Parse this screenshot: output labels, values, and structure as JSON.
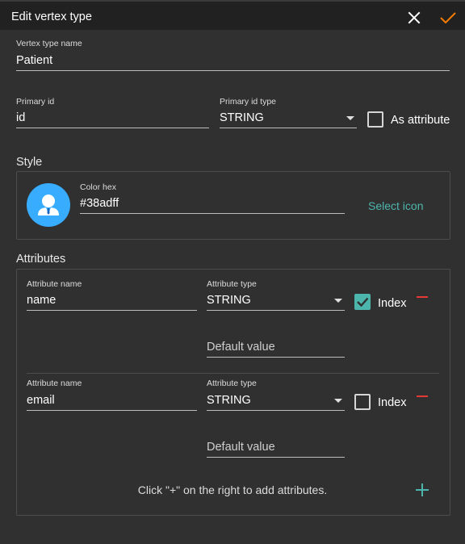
{
  "dialog": {
    "title": "Edit vertex type",
    "close_icon": "close-icon",
    "confirm_icon": "check-icon",
    "confirm_color": "#f57c00"
  },
  "vertex": {
    "name_label": "Vertex type name",
    "name_value": "Patient",
    "primary_id_label": "Primary id",
    "primary_id_value": "id",
    "primary_id_type_label": "Primary id type",
    "primary_id_type_value": "STRING",
    "as_attribute_label": "As attribute",
    "as_attribute_checked": false
  },
  "style": {
    "section_label": "Style",
    "color_hex_label": "Color hex",
    "color_hex_value": "#38adff",
    "avatar_color": "#38adff",
    "avatar_icon": "person-icon",
    "select_icon_label": "Select icon"
  },
  "attributes": {
    "section_label": "Attributes",
    "items": [
      {
        "name_label": "Attribute name",
        "name_value": "name",
        "type_label": "Attribute type",
        "type_value": "STRING",
        "index_label": "Index",
        "index_checked": true,
        "default_placeholder": "Default value"
      },
      {
        "name_label": "Attribute name",
        "name_value": "email",
        "type_label": "Attribute type",
        "type_value": "STRING",
        "index_label": "Index",
        "index_checked": false,
        "default_placeholder": "Default value"
      }
    ],
    "hint": "Click \"+\" on the right to add attributes.",
    "add_icon": "plus-icon",
    "accent_color": "#4db6ac",
    "remove_color": "#e53935"
  }
}
